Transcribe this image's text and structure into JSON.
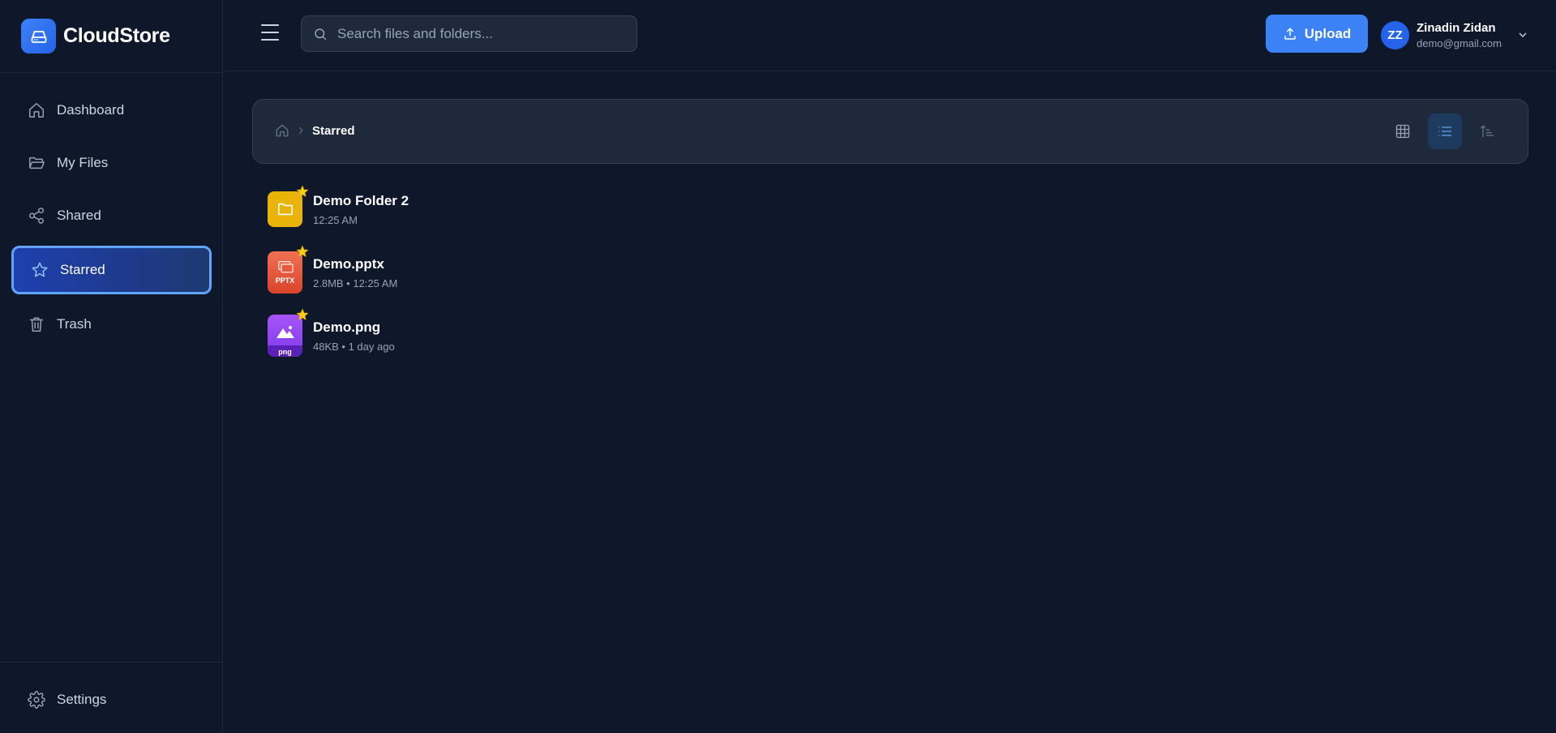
{
  "brand": {
    "name": "CloudStore",
    "accent": "#3b82f6"
  },
  "sidebar": {
    "items": [
      {
        "label": "Dashboard",
        "icon": "home-icon"
      },
      {
        "label": "My Files",
        "icon": "folder-open-icon"
      },
      {
        "label": "Shared",
        "icon": "share-icon"
      },
      {
        "label": "Starred",
        "icon": "star-icon",
        "active": true
      },
      {
        "label": "Trash",
        "icon": "trash-icon"
      }
    ],
    "settings_label": "Settings"
  },
  "header": {
    "search_placeholder": "Search files and folders...",
    "upload_label": "Upload",
    "user": {
      "initials": "ZZ",
      "name": "Zinadin Zidan",
      "email": "demo@gmail.com"
    }
  },
  "breadcrumb": {
    "current": "Starred"
  },
  "files": [
    {
      "name": "Demo Folder 2",
      "meta": "12:25 AM",
      "type": "folder",
      "starred": true
    },
    {
      "name": "Demo.pptx",
      "meta": "2.8MB • 12:25 AM",
      "type": "pptx",
      "ext_label": "PPTX",
      "starred": true
    },
    {
      "name": "Demo.png",
      "meta": "48KB • 1 day ago",
      "type": "png",
      "ext_label": "png",
      "starred": true
    }
  ]
}
